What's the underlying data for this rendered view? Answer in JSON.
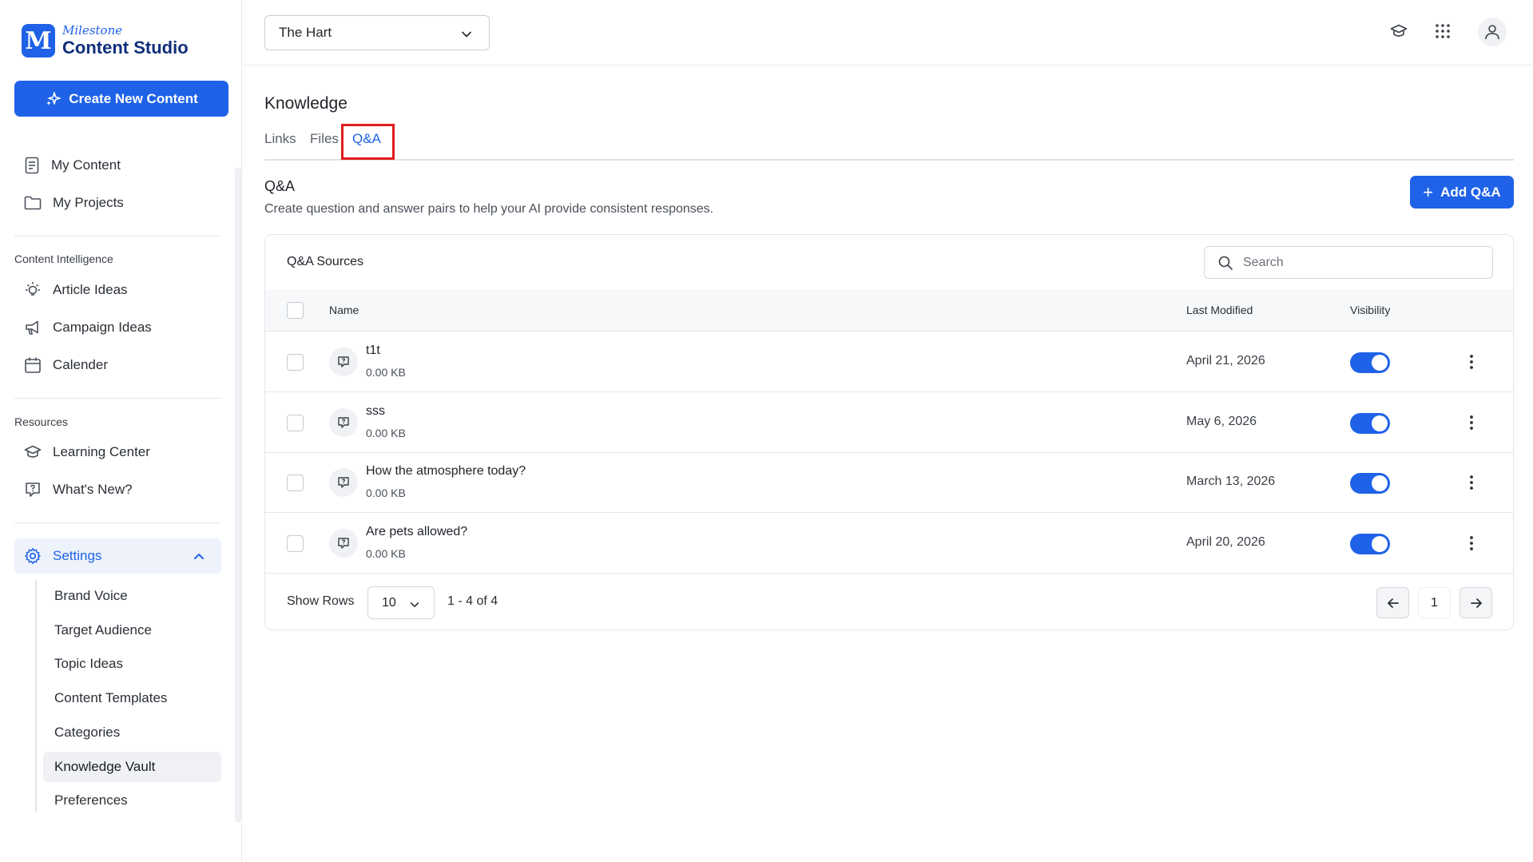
{
  "app": {
    "logo_letter": "M",
    "logo_sub": "Milestone",
    "logo_main": "Content Studio",
    "brand_color": "#1f62e8"
  },
  "sidebar": {
    "create_label": "Create New Content",
    "items": [
      {
        "label": "My Content",
        "icon": "document-icon"
      },
      {
        "label": "My Projects",
        "icon": "folder-icon"
      }
    ],
    "content_intelligence_label": "Content Intelligence",
    "ci_items": [
      {
        "label": "Article Ideas",
        "icon": "lightbulb-icon"
      },
      {
        "label": "Campaign Ideas",
        "icon": "megaphone-icon"
      },
      {
        "label": "Calender",
        "icon": "calendar-icon"
      }
    ],
    "resources_label": "Resources",
    "res_items": [
      {
        "label": "Learning Center",
        "icon": "graduation-cap-icon"
      },
      {
        "label": "What's New?",
        "icon": "question-bubble-icon"
      }
    ],
    "settings_label": "Settings",
    "settings_items": [
      "Brand Voice",
      "Target Audience",
      "Topic Ideas",
      "Content Templates",
      "Categories",
      "Knowledge Vault",
      "Preferences"
    ]
  },
  "topbar": {
    "brand_selected": "The Hart"
  },
  "main": {
    "title": "Knowledge",
    "tabs": [
      "Links",
      "Files",
      "Q&A"
    ],
    "section_title": "Q&A",
    "section_desc": "Create question and answer pairs to help your AI provide consistent responses.",
    "add_label": "Add Q&A",
    "card_title": "Q&A Sources",
    "search_placeholder": "Search",
    "columns": {
      "name": "Name",
      "modified": "Last Modified",
      "visibility": "Visibility"
    },
    "rows": [
      {
        "name": "t1t",
        "size": "0.00 KB",
        "date": "April 21, 2026",
        "visible": true
      },
      {
        "name": "sss",
        "size": "0.00 KB",
        "date": "May 6, 2026",
        "visible": true
      },
      {
        "name": "How the atmosphere today?",
        "size": "0.00 KB",
        "date": "March 13, 2026",
        "visible": true
      },
      {
        "name": "Are pets allowed?",
        "size": "0.00 KB",
        "date": "April 20, 2026",
        "visible": true
      }
    ],
    "footer": {
      "show_rows_label": "Show Rows",
      "rows_value": "10",
      "range": "1 - 4 of 4",
      "page": "1"
    }
  }
}
